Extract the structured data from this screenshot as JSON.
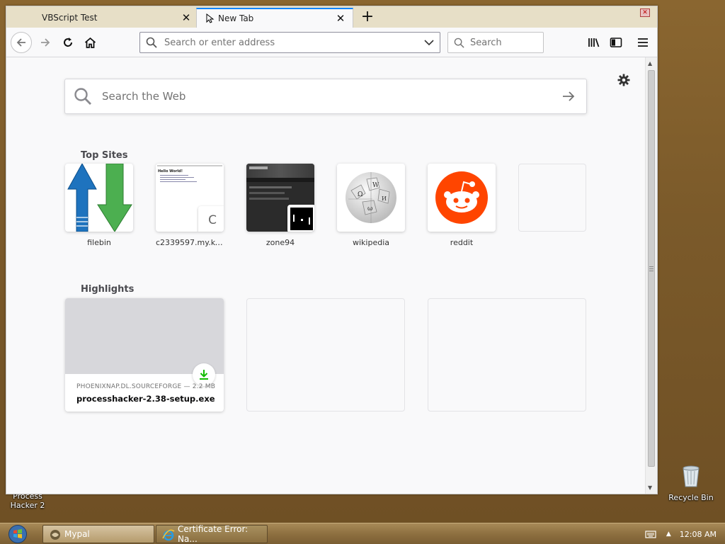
{
  "browser": {
    "tabs": [
      {
        "title": "VBScript Test",
        "active": false
      },
      {
        "title": "New Tab",
        "active": true
      }
    ],
    "urlbar": {
      "placeholder": "Search or enter address",
      "value": ""
    },
    "searchbar": {
      "placeholder": "Search"
    }
  },
  "newtab": {
    "web_search": {
      "placeholder": "Search the Web"
    },
    "top_sites_title": "Top Sites",
    "top_sites": [
      {
        "label": "filebin",
        "icon": "filebin-arrows-icon"
      },
      {
        "label": "c2339597.my.kevi...",
        "icon": "page-thumbnail",
        "thumb_title": "Hello World!",
        "thumb_letter": "C"
      },
      {
        "label": "zone94",
        "icon": "zone94-thumbnail"
      },
      {
        "label": "wikipedia",
        "icon": "wikipedia-globe-icon"
      },
      {
        "label": "reddit",
        "icon": "reddit-alien-icon"
      },
      {
        "label": "",
        "icon": "empty"
      }
    ],
    "highlights_title": "Highlights",
    "highlights": [
      {
        "source": "PHOENIXNAP.DL.SOURCEFORGE — 2.2 MB",
        "filename": "processhacker-2.38-setup.exe",
        "icon": "download-icon"
      }
    ]
  },
  "desktop": {
    "icons": [
      {
        "label": "Process\nHacker 2"
      },
      {
        "label": "Recycle Bin"
      }
    ]
  },
  "taskbar": {
    "buttons": [
      {
        "label": "Mypal",
        "active": true
      },
      {
        "label": "Certificate Error: Na...",
        "active": false
      }
    ],
    "clock": "12:08 AM"
  },
  "colors": {
    "accent": "#0a84ff",
    "reddit": "#ff4500",
    "filebin_blue": "#1e73be",
    "filebin_green": "#4caf50",
    "download_green": "#12bc00"
  }
}
